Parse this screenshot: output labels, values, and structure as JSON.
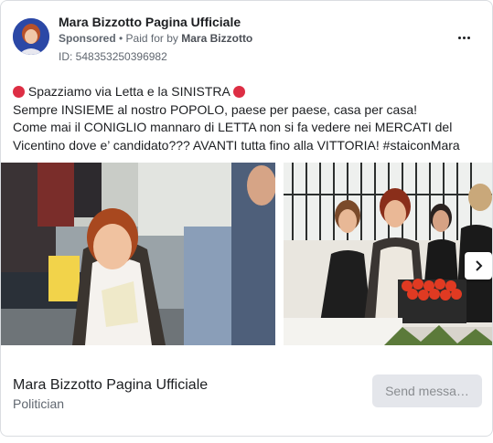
{
  "header": {
    "page_name": "Mara Bizzotto Pagina Ufficiale",
    "sponsored_label": "Sponsored",
    "paid_prefix": "• Paid for by",
    "paid_by": "Mara Bizzotto",
    "ad_id": "ID: 548353250396982"
  },
  "body": {
    "line1": "Spazziamo via Letta e la SINISTRA",
    "line2": "Sempre INSIEME al nostro POPOLO, paese per paese, casa per casa!",
    "line3": "Come mai il CONIGLIO mannaro di LETTA non si fa vedere nei MERCATI del",
    "line4": "Vicentino dove e’ candidato??? AVANTI tutta fino alla VITTORIA! #staiconMara"
  },
  "carousel": {
    "slides": [
      "market-photo-1",
      "market-photo-2"
    ]
  },
  "footer": {
    "page_name": "Mara Bizzotto Pagina Ufficiale",
    "category": "Politician",
    "cta_label": "Send messa…"
  },
  "icons": {
    "more": "more-options-icon",
    "next": "chevron-right-icon",
    "emoji": "red-circle-emoji"
  },
  "colors": {
    "emoji_red": "#dd2e44",
    "cta_bg": "#e4e6eb",
    "cta_text": "#8a8d91",
    "secondary_text": "#606770"
  }
}
